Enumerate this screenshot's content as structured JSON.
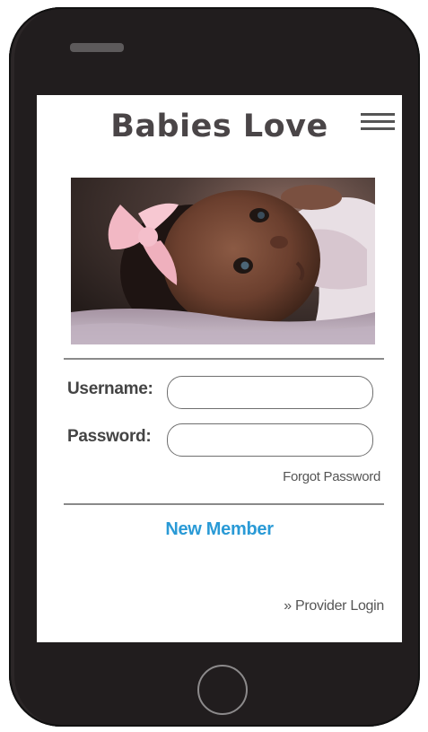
{
  "app": {
    "title": "Babies Love"
  },
  "hero": {
    "icon": "baby-photo"
  },
  "login": {
    "username_label": "Username:",
    "username_value": "",
    "password_label": "Password:",
    "password_value": "",
    "forgot_label": "Forgot Password"
  },
  "new_member_label": "New Member",
  "provider_login_label": "» Provider Login",
  "colors": {
    "device": "#211d1e",
    "title": "#4a4547",
    "link_accent": "#2a9ad6",
    "screen": "#ffffff"
  }
}
